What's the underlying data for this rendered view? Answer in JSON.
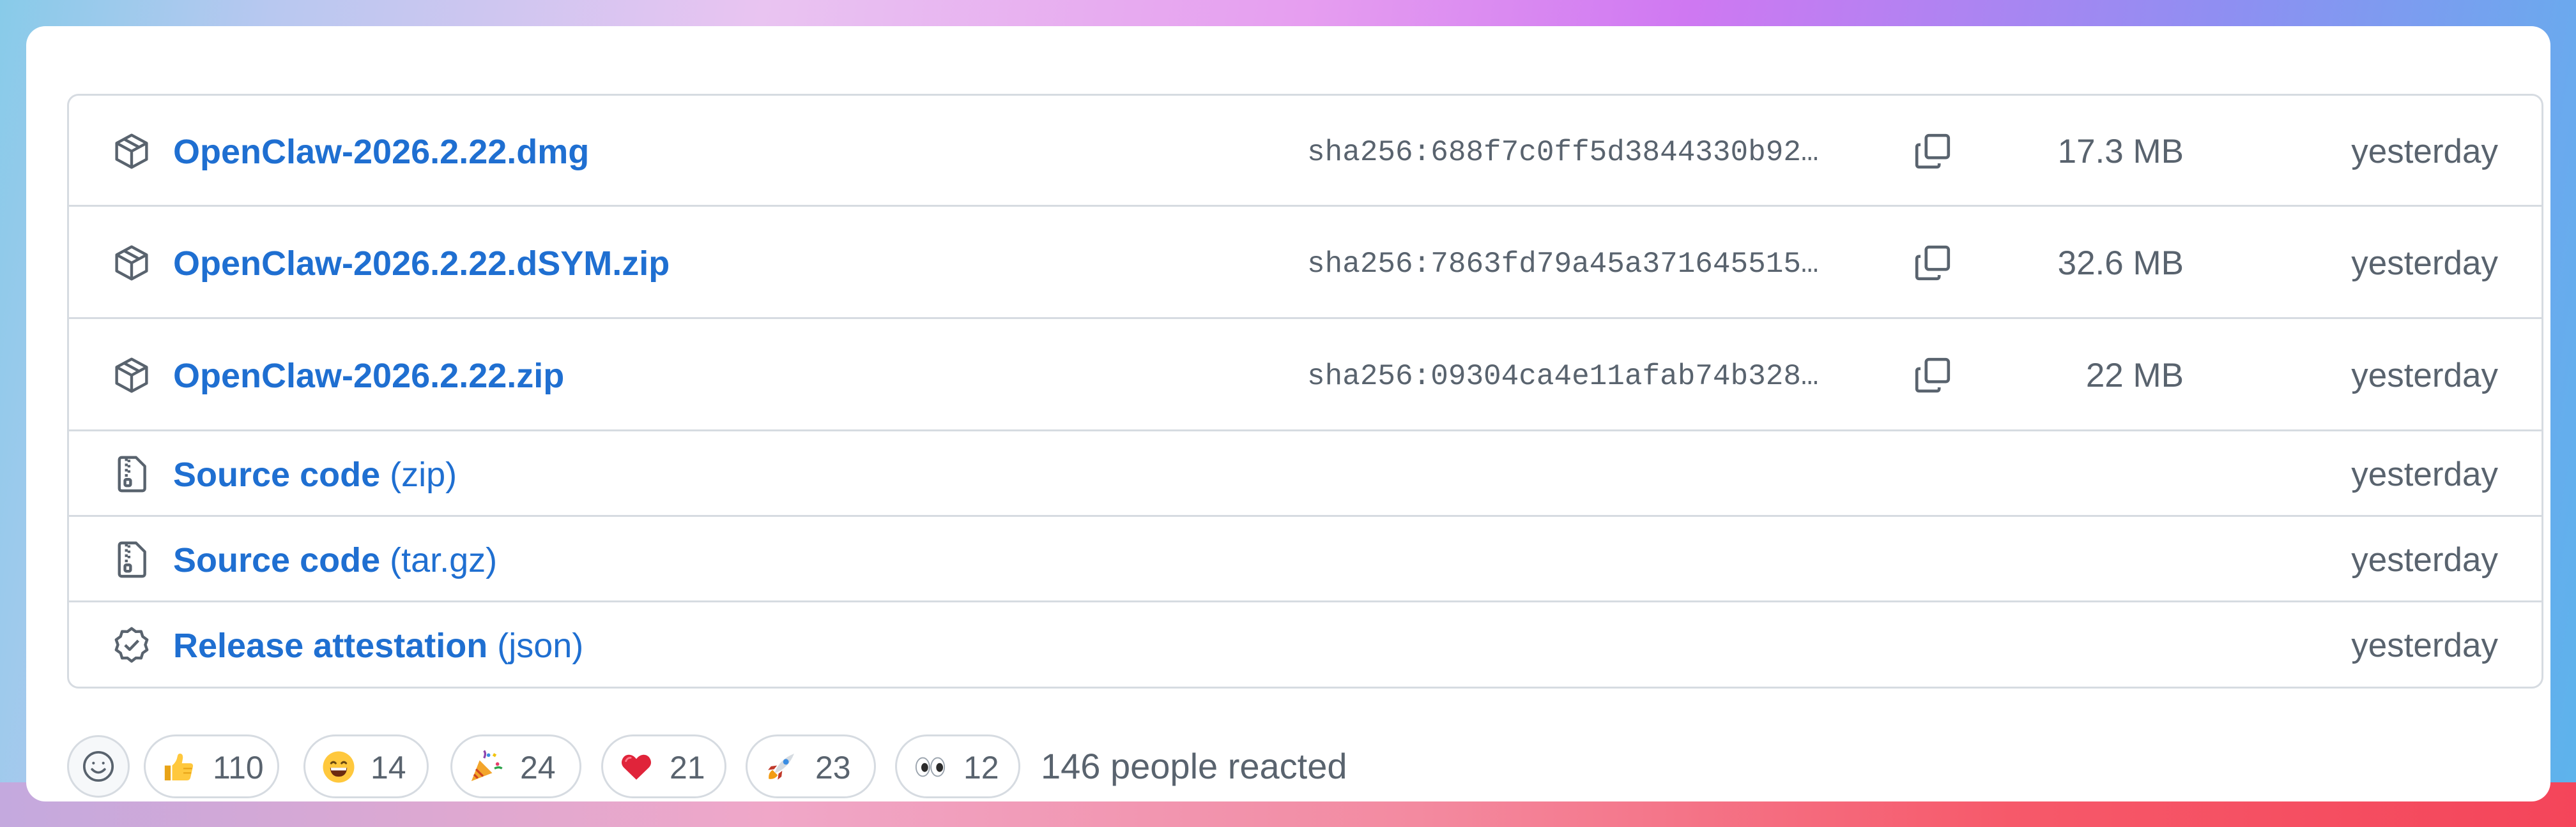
{
  "assets": [
    {
      "name": "OpenClaw-2026.2.22.dmg",
      "format": "",
      "hash": "sha256:688f7c0ff5d3844330b92…",
      "size": "17.3 MB",
      "date": "yesterday",
      "icon": "package-icon"
    },
    {
      "name": "OpenClaw-2026.2.22.dSYM.zip",
      "format": "",
      "hash": "sha256:7863fd79a45a371645515…",
      "size": "32.6 MB",
      "date": "yesterday",
      "icon": "package-icon"
    },
    {
      "name": "OpenClaw-2026.2.22.zip",
      "format": "",
      "hash": "sha256:09304ca4e11afab74b328…",
      "size": "22 MB",
      "date": "yesterday",
      "icon": "package-icon"
    },
    {
      "name": "Source code",
      "format": "(zip)",
      "hash": "",
      "size": "",
      "date": "yesterday",
      "icon": "file-zip-icon"
    },
    {
      "name": "Source code",
      "format": "(tar.gz)",
      "hash": "",
      "size": "",
      "date": "yesterday",
      "icon": "file-zip-icon"
    },
    {
      "name": "Release attestation",
      "format": "(json)",
      "hash": "",
      "size": "",
      "date": "yesterday",
      "icon": "verified-badge-icon"
    }
  ],
  "reactions": [
    {
      "emoji": "thumbs-up-icon",
      "count": "110"
    },
    {
      "emoji": "grinning-face-icon",
      "count": "14"
    },
    {
      "emoji": "party-popper-icon",
      "count": "24"
    },
    {
      "emoji": "red-heart-icon",
      "count": "21"
    },
    {
      "emoji": "rocket-icon",
      "count": "23"
    },
    {
      "emoji": "eyes-icon",
      "count": "12"
    }
  ],
  "reaction_summary": "146 people reacted",
  "colors": {
    "link": "#1f6fd1",
    "muted": "#59636e",
    "border": "#d6dbe1"
  }
}
